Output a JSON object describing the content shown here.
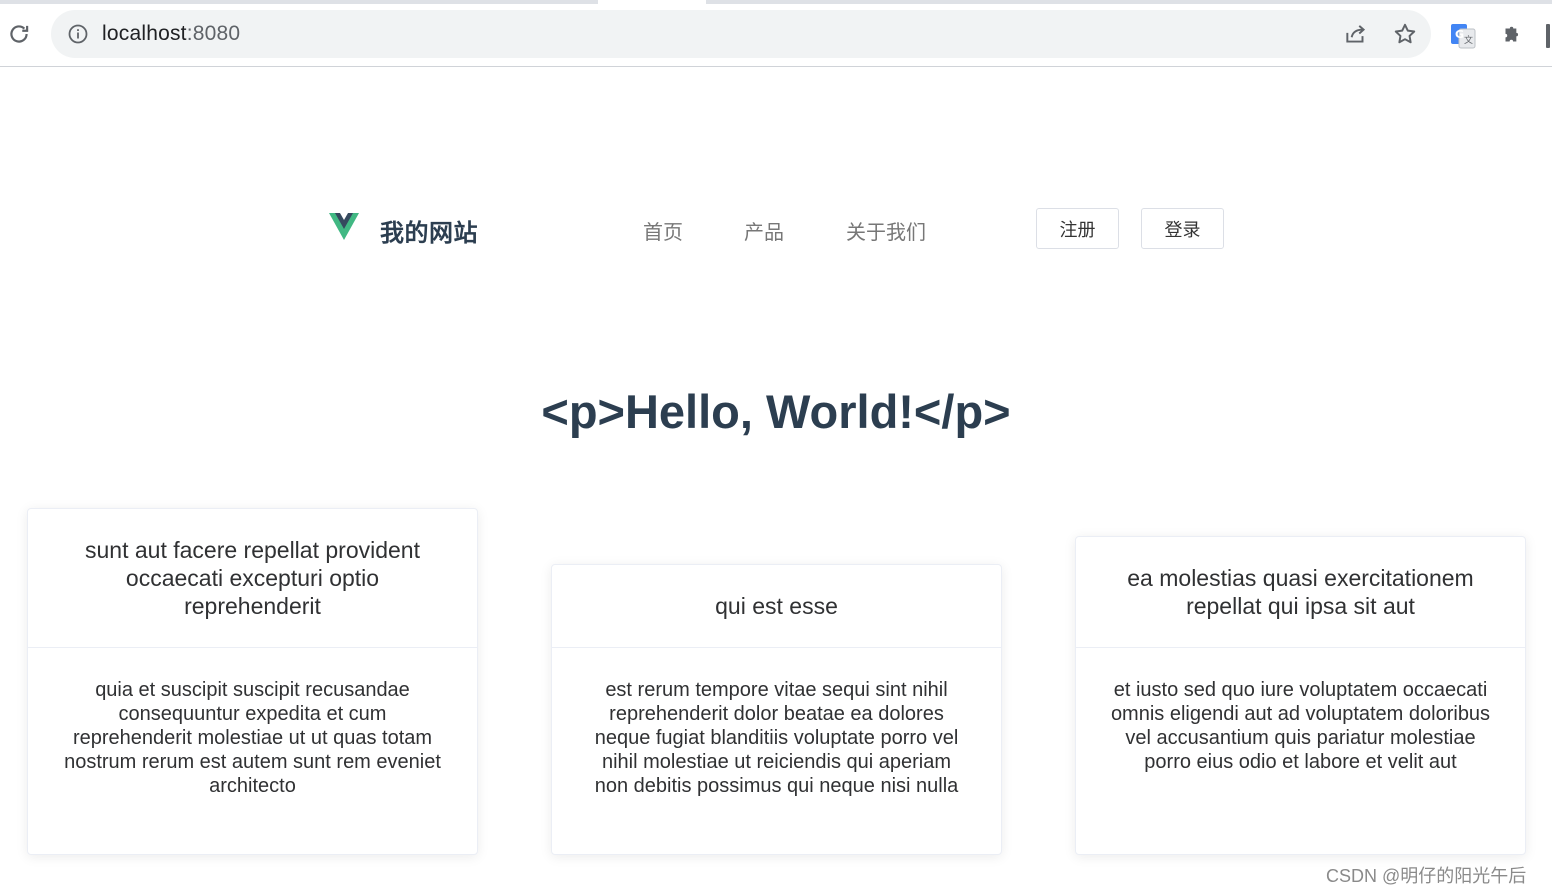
{
  "browser": {
    "url_host": "localhost",
    "url_port": ":8080"
  },
  "site": {
    "title": "我的网站",
    "nav": [
      "首页",
      "产品",
      "关于我们"
    ],
    "register_label": "注册",
    "login_label": "登录"
  },
  "main": {
    "heading": "<p>Hello, World!</p>"
  },
  "cards": [
    {
      "title": "sunt aut facere repellat provident occaecati excepturi optio reprehenderit",
      "body": "quia et suscipit suscipit recusandae consequuntur expedita et cum reprehenderit molestiae ut ut quas totam nostrum rerum est autem sunt rem eveniet architecto"
    },
    {
      "title": "qui est esse",
      "body": "est rerum tempore vitae sequi sint nihil reprehenderit dolor beatae ea dolores neque fugiat blanditiis voluptate porro vel nihil molestiae ut reiciendis qui aperiam non debitis possimus qui neque nisi nulla"
    },
    {
      "title": "ea molestias quasi exercitationem repellat qui ipsa sit aut",
      "body": "et iusto sed quo iure voluptatem occaecati omnis eligendi aut ad voluptatem doloribus vel accusantium quis pariatur molestiae porro eius odio et labore et velit aut"
    }
  ],
  "watermark": "CSDN @明仔的阳光午后",
  "colors": {
    "vue_green": "#41b883",
    "vue_dark": "#35495e",
    "text_dark": "#2c3e50"
  },
  "icons": [
    "reload-icon",
    "info-icon",
    "share-icon",
    "star-icon",
    "translate-icon",
    "extensions-icon",
    "vue-logo"
  ]
}
